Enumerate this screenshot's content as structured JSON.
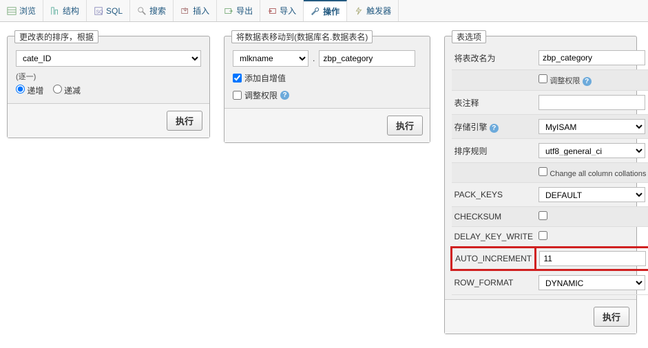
{
  "tabs": {
    "browse": "浏览",
    "structure": "结构",
    "sql": "SQL",
    "search": "搜索",
    "insert": "插入",
    "export": "导出",
    "import": "导入",
    "operations": "操作",
    "triggers": "触发器"
  },
  "panel1": {
    "title": "更改表的排序，根据",
    "select_value": "cate_ID",
    "note": "(逐一)",
    "radio_asc": "递增",
    "radio_desc": "递减",
    "submit": "执行"
  },
  "panel2": {
    "title": "将数据表移动到(数据库名.数据表名)",
    "db_value": "mlkname",
    "table_value": "zbp_category",
    "add_autoinc": "添加自增值",
    "adjust_priv": "调整权限",
    "submit": "执行"
  },
  "panel3": {
    "title": "表选项",
    "rows": {
      "rename_label": "将表改名为",
      "rename_value": "zbp_category",
      "adjust_priv_label": "调整权限",
      "comment_label": "表注释",
      "comment_value": "",
      "engine_label": "存储引擎",
      "engine_value": "MyISAM",
      "collation_label": "排序规则",
      "collation_value": "utf8_general_ci",
      "change_all_coll": "Change all column collations",
      "pack_keys_label": "PACK_KEYS",
      "pack_keys_value": "DEFAULT",
      "checksum_label": "CHECKSUM",
      "delay_label": "DELAY_KEY_WRITE",
      "autoinc_label": "AUTO_INCREMENT",
      "autoinc_value": "11",
      "rowformat_label": "ROW_FORMAT",
      "rowformat_value": "DYNAMIC"
    },
    "submit": "执行"
  },
  "colors": {
    "link": "#235a81",
    "highlight": "#d02020"
  }
}
